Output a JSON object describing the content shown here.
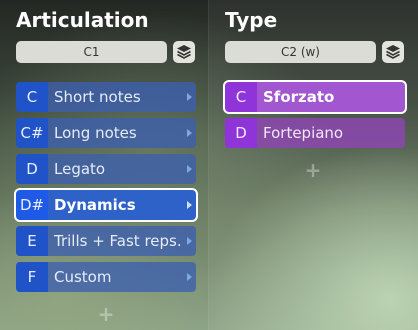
{
  "articulation": {
    "title": "Articulation",
    "selector": "C1",
    "items": [
      {
        "key": "C",
        "label": "Short notes"
      },
      {
        "key": "C#",
        "label": "Long notes"
      },
      {
        "key": "D",
        "label": "Legato"
      },
      {
        "key": "D#",
        "label": "Dynamics"
      },
      {
        "key": "E",
        "label": "Trills + Fast reps."
      },
      {
        "key": "F",
        "label": "Custom"
      }
    ],
    "selected_index": 3,
    "add_label": "+"
  },
  "type": {
    "title": "Type",
    "selector": "C2 (w)",
    "items": [
      {
        "key": "C",
        "label": "Sforzato"
      },
      {
        "key": "D",
        "label": "Fortepiano"
      }
    ],
    "selected_index": 0,
    "add_label": "+"
  },
  "icons": {
    "stack": "layers-stack-icon",
    "arrow": "chevron-right-icon"
  },
  "colors": {
    "articulation_key": "#2052c8",
    "articulation_row": "#3c5faf",
    "type_key": "#8e34d8",
    "type_row": "#8c46af"
  }
}
